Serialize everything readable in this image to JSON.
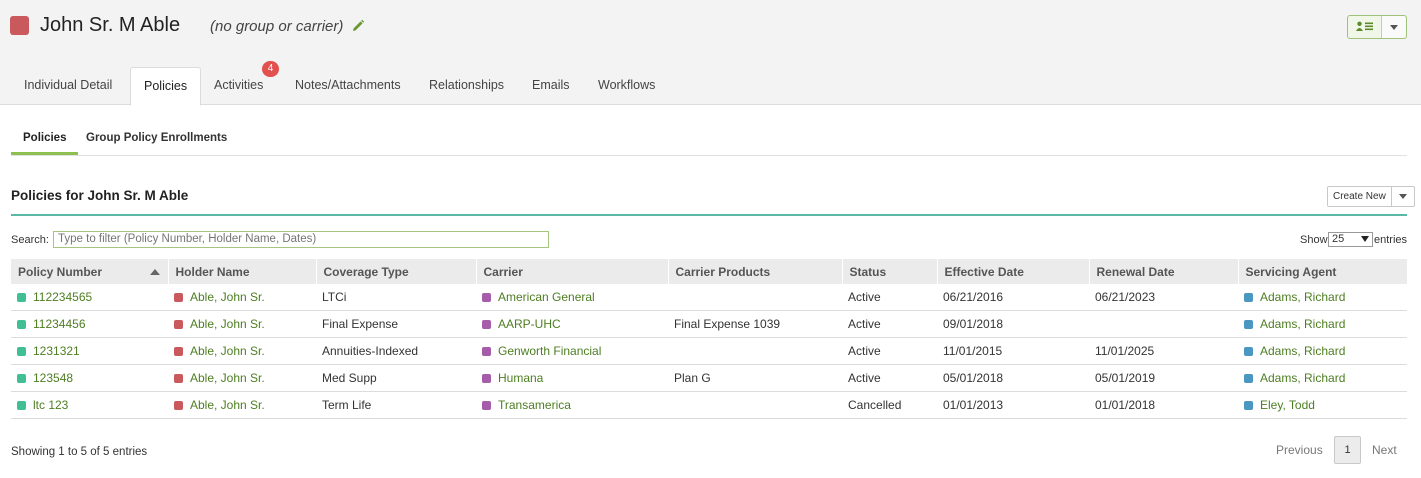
{
  "header": {
    "contact_name": "John Sr. M Able",
    "group_carrier": "(no group or carrier)",
    "accent_color": "#c9595c"
  },
  "tabs": [
    {
      "label": "Individual Detail",
      "active": false
    },
    {
      "label": "Policies",
      "active": true
    },
    {
      "label": "Activities",
      "active": false,
      "badge": "4"
    },
    {
      "label": "Notes/Attachments",
      "active": false
    },
    {
      "label": "Relationships",
      "active": false
    },
    {
      "label": "Emails",
      "active": false
    },
    {
      "label": "Workflows",
      "active": false
    }
  ],
  "subtabs": [
    {
      "label": "Policies",
      "active": true
    },
    {
      "label": "Group Policy Enrollments",
      "active": false
    }
  ],
  "section": {
    "title": "Policies for John Sr. M Able",
    "create_new_label": "Create New"
  },
  "search": {
    "label": "Search:",
    "placeholder": "Type to filter (Policy Number, Holder Name, Dates)"
  },
  "page_length": {
    "show_label": "Show",
    "value": "25",
    "entries_label": "entries"
  },
  "table": {
    "columns": [
      "Policy Number",
      "Holder Name",
      "Coverage Type",
      "Carrier",
      "Carrier Products",
      "Status",
      "Effective Date",
      "Renewal Date",
      "Servicing Agent"
    ],
    "sorted_column": "Policy Number",
    "colors": {
      "policy": "#3fbf93",
      "holder": "#c9595c",
      "carrier": "#a55ca9",
      "agent": "#4a97c2"
    },
    "rows": [
      {
        "policy_number": "112234565",
        "holder": "Able, John Sr.",
        "coverage": "LTCi",
        "carrier": "American General",
        "products": "",
        "status": "Active",
        "effective": "06/21/2016",
        "renewal": "06/21/2023",
        "agent": "Adams, Richard"
      },
      {
        "policy_number": "11234456",
        "holder": "Able, John Sr.",
        "coverage": "Final Expense",
        "carrier": "AARP-UHC",
        "products": "Final Expense 1039",
        "status": "Active",
        "effective": "09/01/2018",
        "renewal": "",
        "agent": "Adams, Richard"
      },
      {
        "policy_number": "1231321",
        "holder": "Able, John Sr.",
        "coverage": "Annuities-Indexed",
        "carrier": "Genworth Financial",
        "products": "",
        "status": "Active",
        "effective": "11/01/2015",
        "renewal": "11/01/2025",
        "agent": "Adams, Richard"
      },
      {
        "policy_number": "123548",
        "holder": "Able, John Sr.",
        "coverage": "Med Supp",
        "carrier": "Humana",
        "products": "Plan G",
        "status": "Active",
        "effective": "05/01/2018",
        "renewal": "05/01/2019",
        "agent": "Adams, Richard"
      },
      {
        "policy_number": "ltc 123",
        "holder": "Able, John Sr.",
        "coverage": "Term Life",
        "carrier": "Transamerica",
        "products": "",
        "status": "Cancelled",
        "effective": "01/01/2013",
        "renewal": "01/01/2018",
        "agent": "Eley, Todd"
      }
    ]
  },
  "footer": {
    "showing": "Showing 1 to 5 of 5 entries",
    "previous": "Previous",
    "page": "1",
    "next": "Next"
  }
}
